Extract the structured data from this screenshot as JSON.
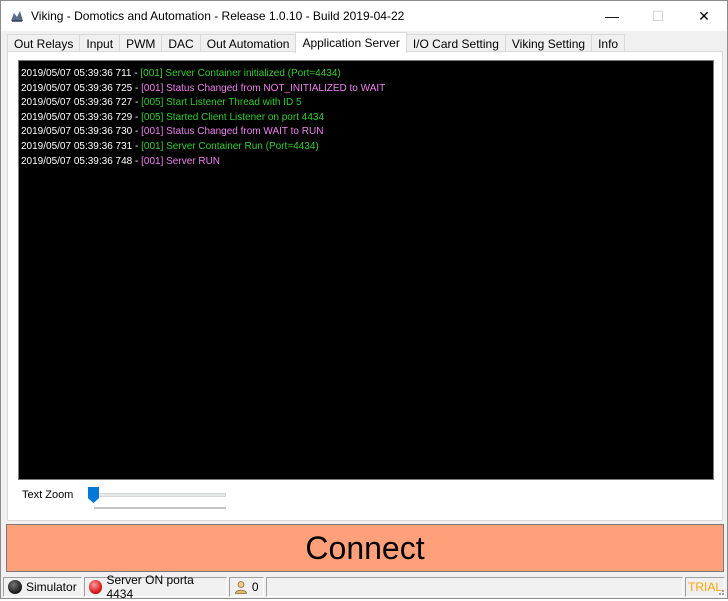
{
  "window": {
    "title": "Viking - Domotics and Automation - Release 1.0.10 - Build 2019-04-22",
    "controls": {
      "minimize": "—",
      "maximize": "☐",
      "close": "✕"
    }
  },
  "tabs": [
    {
      "label": "Out Relays"
    },
    {
      "label": "Input"
    },
    {
      "label": "PWM"
    },
    {
      "label": "DAC"
    },
    {
      "label": "Out Automation"
    },
    {
      "label": "Application Server"
    },
    {
      "label": "I/O Card Setting"
    },
    {
      "label": "Viking Setting"
    },
    {
      "label": "Info"
    }
  ],
  "active_tab": "Application Server",
  "log": [
    {
      "ts": "2019/05/07 05:39:36 711 - ",
      "msg": "[001] Server Container initialized (Port=4434)",
      "color": "green"
    },
    {
      "ts": "2019/05/07 05:39:36 725 - ",
      "msg": "[001] Status Changed from NOT_INITIALIZED to WAIT",
      "color": "purple"
    },
    {
      "ts": "2019/05/07 05:39:36 727 - ",
      "msg": "[005] Start Listener Thread with ID 5",
      "color": "green"
    },
    {
      "ts": "2019/05/07 05:39:36 729 - ",
      "msg": "[005] Started Client Listener on port 4434",
      "color": "green"
    },
    {
      "ts": "2019/05/07 05:39:36 730 - ",
      "msg": "[001] Status Changed from WAIT to RUN",
      "color": "purple"
    },
    {
      "ts": "2019/05/07 05:39:36 731 - ",
      "msg": "[001] Server Container Run (Port=4434)",
      "color": "green"
    },
    {
      "ts": "2019/05/07 05:39:36 748 - ",
      "msg": "[001] Server RUN",
      "color": "purple"
    }
  ],
  "zoom": {
    "label": "Text Zoom",
    "level": 0
  },
  "connect_label": "Connect",
  "status": {
    "simulator": "Simulator",
    "server": "Server ON porta 4434",
    "clients": "0",
    "trial": "TRIAL"
  },
  "colors": {
    "console_bg": "#000000",
    "log_green": "#32cd32",
    "log_purple": "#ee82ee",
    "connect_bg": "#ffa07a",
    "trial": "#ffa500",
    "slider_thumb": "#0078d7"
  }
}
